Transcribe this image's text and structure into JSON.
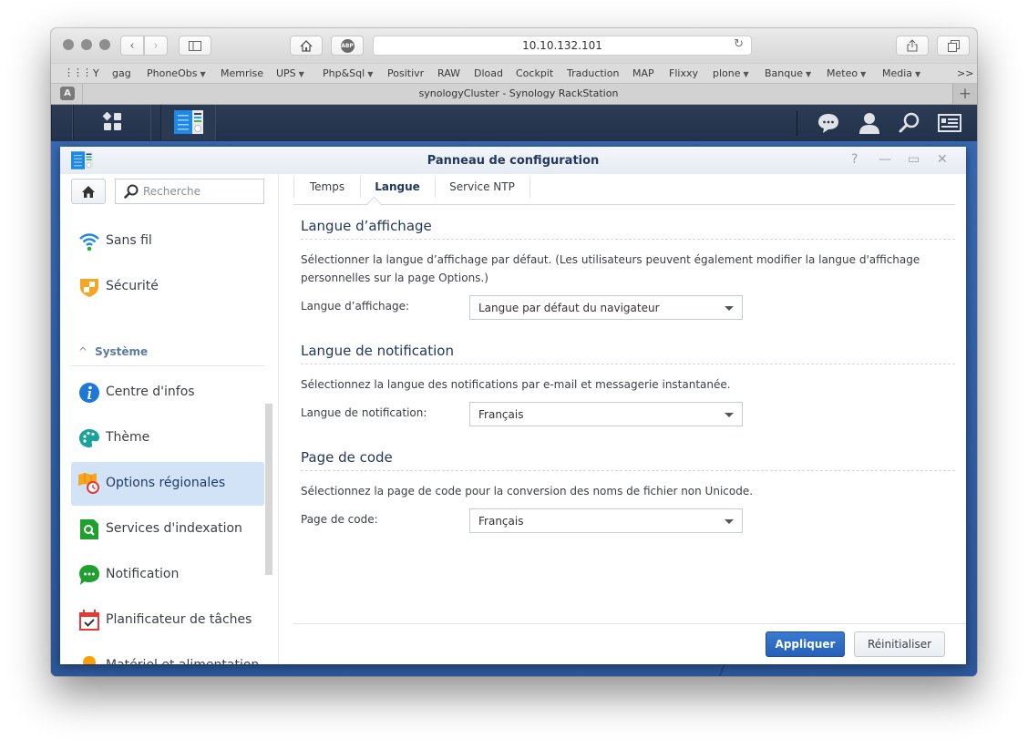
{
  "browser": {
    "url": "10.10.132.101",
    "tab_title": "synologyCluster - Synology RackStation",
    "tab_badge": "A",
    "adblock_label": "ABP",
    "new_tab": "+",
    "bookmarks_overflow": ">>",
    "bookmarks": [
      {
        "label": "Y",
        "menu": false
      },
      {
        "label": "gag",
        "menu": false
      },
      {
        "label": "PhoneObs",
        "menu": true
      },
      {
        "label": "Memrise",
        "menu": false
      },
      {
        "label": "UPS",
        "menu": true
      },
      {
        "label": "Php&Sql",
        "menu": true
      },
      {
        "label": "Positivr",
        "menu": false
      },
      {
        "label": "RAW",
        "menu": false
      },
      {
        "label": "Dload",
        "menu": false
      },
      {
        "label": "Cockpit",
        "menu": false
      },
      {
        "label": "Traduction",
        "menu": false
      },
      {
        "label": "MAP",
        "menu": false
      },
      {
        "label": "Flixxy",
        "menu": false
      },
      {
        "label": "plone",
        "menu": true
      },
      {
        "label": "Banque",
        "menu": true
      },
      {
        "label": "Meteo",
        "menu": true
      },
      {
        "label": "Media",
        "menu": true
      }
    ]
  },
  "window": {
    "title": "Panneau de configuration",
    "help": "?",
    "minimize": "—",
    "maximize": "▭",
    "close": "✕"
  },
  "sidebar": {
    "search_placeholder": "Recherche",
    "group_label": "Système",
    "items": [
      {
        "label": "Sans fil",
        "icon": "wifi-icon",
        "active": false
      },
      {
        "label": "Sécurité",
        "icon": "shield-icon",
        "active": false
      },
      {
        "label": "Centre d'infos",
        "icon": "info-icon",
        "active": false
      },
      {
        "label": "Thème",
        "icon": "palette-icon",
        "active": false
      },
      {
        "label": "Options régionales",
        "icon": "regional-options-icon",
        "active": true
      },
      {
        "label": "Services d'indexation",
        "icon": "indexing-icon",
        "active": false
      },
      {
        "label": "Notification",
        "icon": "notification-icon",
        "active": false
      },
      {
        "label": "Planificateur de tâches",
        "icon": "task-scheduler-icon",
        "active": false
      },
      {
        "label": "Matériel et alimentation",
        "icon": "lightbulb-icon",
        "active": false
      }
    ]
  },
  "tabs": [
    {
      "label": "Temps",
      "active": false
    },
    {
      "label": "Langue",
      "active": true
    },
    {
      "label": "Service NTP",
      "active": false
    }
  ],
  "sections": {
    "display": {
      "title": "Langue d’affichage",
      "desc_line1": "Sélectionner la langue d’affichage par défaut. (Les utilisateurs peuvent également modifier la langue d'affichage",
      "desc_line2": "personnelles sur la page Options.)",
      "field_label": "Langue d’affichage:",
      "value": "Langue par défaut du navigateur"
    },
    "notification": {
      "title": "Langue de notification",
      "desc": "Sélectionnez la langue des notifications par e-mail et messagerie instantanée.",
      "field_label": "Langue de notification:",
      "value": "Français"
    },
    "codepage": {
      "title": "Page de code",
      "desc": "Sélectionnez la page de code pour la conversion des noms de fichier non Unicode.",
      "field_label": "Page de code:",
      "value": "Français"
    }
  },
  "footer": {
    "apply": "Appliquer",
    "reset": "Réinitialiser"
  },
  "colors": {
    "accent": "#2a67bd",
    "active_item": "#d3e3f7",
    "desktop": "#3368b0"
  }
}
